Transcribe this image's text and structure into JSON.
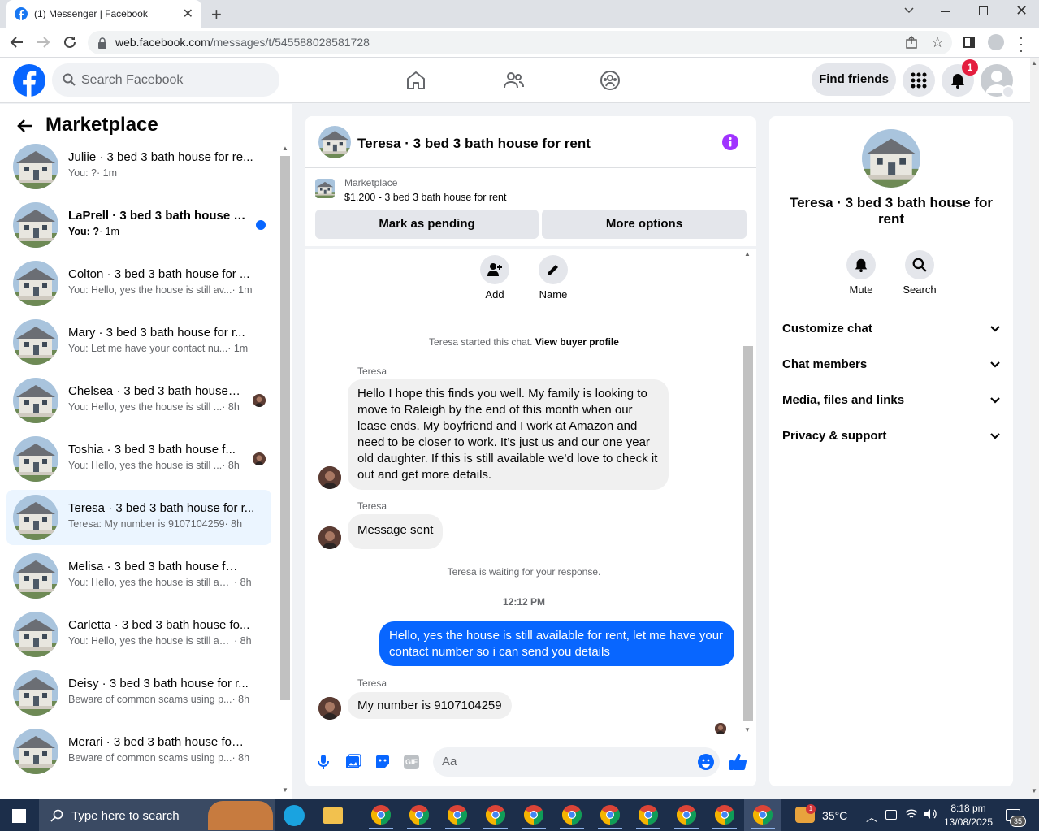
{
  "browser": {
    "tab_title": "(1) Messenger | Facebook",
    "url_host": "web.facebook.com",
    "url_path": "/messages/t/545588028581728"
  },
  "fb": {
    "search_placeholder": "Search Facebook",
    "find_friends": "Find friends",
    "notif_count": "1"
  },
  "sidebar": {
    "title": "Marketplace",
    "items": [
      {
        "name": "Juliie · 3 bed 3 bath house for re...",
        "preview": "You: ?",
        "time": "· 1m",
        "unread": false
      },
      {
        "name": "LaPrell · 3 bed 3 bath house fo...",
        "preview": "You: ?",
        "time": "· 1m",
        "unread": true
      },
      {
        "name": "Colton · 3 bed 3 bath house for ...",
        "preview": "You: Hello, yes the house is still av...",
        "time": "· 1m",
        "unread": false
      },
      {
        "name": "Mary · 3 bed 3 bath house for r...",
        "preview": "You: Let me have your contact nu...",
        "time": "· 1m",
        "unread": false
      },
      {
        "name": "Chelsea · 3 bed 3 bath house ...",
        "preview": "You: Hello, yes the house is still ...",
        "time": "· 8h",
        "unread": false
      },
      {
        "name": "Toshia · 3 bed 3 bath house f...",
        "preview": "You: Hello, yes the house is still ...",
        "time": "· 8h",
        "unread": false
      },
      {
        "name": "Teresa · 3 bed 3 bath house for r...",
        "preview": "Teresa: My number is 9107104259",
        "time": "· 8h",
        "unread": false
      },
      {
        "name": "Melisa · 3 bed 3 bath house for ...",
        "preview": "You: Hello, yes the house is still ava...",
        "time": "· 8h",
        "unread": false
      },
      {
        "name": "Carletta · 3 bed 3 bath house fo...",
        "preview": "You: Hello, yes the house is still ava...",
        "time": "· 8h",
        "unread": false
      },
      {
        "name": "Deisy · 3 bed 3 bath house for r...",
        "preview": "Beware of common scams using p...",
        "time": "· 8h",
        "unread": false
      },
      {
        "name": "Merari · 3 bed 3 bath house for ...",
        "preview": "Beware of common scams using p...",
        "time": "· 8h",
        "unread": false
      }
    ]
  },
  "chat": {
    "title": "Teresa · 3 bed 3 bath house for rent",
    "listing_label": "Marketplace",
    "listing_title": "$1,200 - 3 bed 3 bath house for rent",
    "btn_pending": "Mark as pending",
    "btn_more": "More options",
    "add_label": "Add",
    "name_label": "Name",
    "started_text": "Teresa started this chat.",
    "buyer_profile_link": "View buyer profile",
    "sender_name": "Teresa",
    "msg1": "Hello I hope this finds you well. My family is looking to move to Raleigh by the end of this month when our lease ends. My boyfriend and I work at Amazon and need to be closer to work. It’s just us and our one year old daughter. If this is still available we’d love to check it out and get more details.",
    "msg2": "Message sent",
    "waiting_text": "Teresa is waiting for your response.",
    "timestamp": "12:12 PM",
    "msg3": "Hello, yes the house is still available for rent, let me have your contact number so i can send you  details",
    "msg4": "My number is 9107104259",
    "composer_placeholder": "Aa"
  },
  "right": {
    "title": "Teresa · 3 bed 3 bath house for rent",
    "mute": "Mute",
    "search": "Search",
    "sections": [
      "Customize chat",
      "Chat members",
      "Media, files and links",
      "Privacy & support"
    ]
  },
  "taskbar": {
    "search_placeholder": "Type here to search",
    "temp": "35°C",
    "time": "8:18 pm",
    "date": "13/08/2025",
    "notif": "35",
    "weather_badge": "1"
  }
}
